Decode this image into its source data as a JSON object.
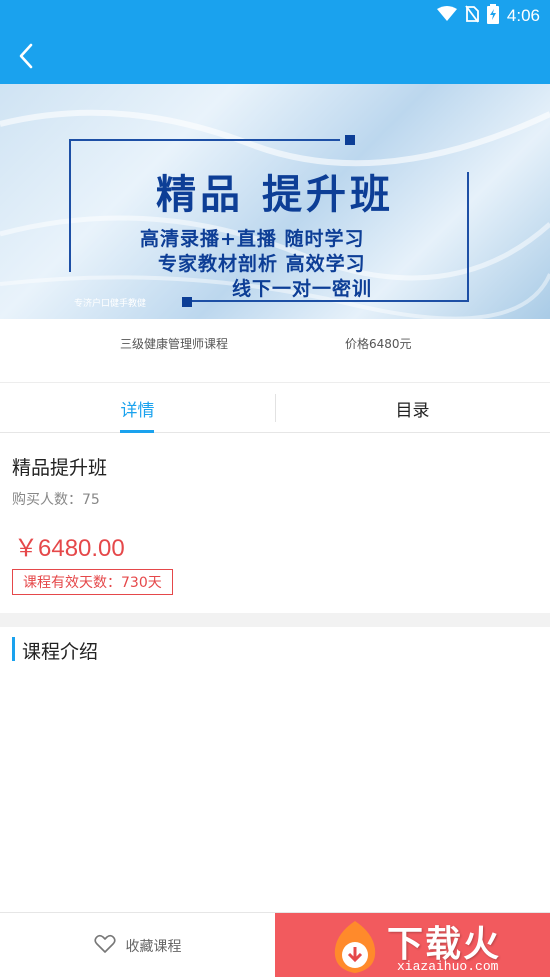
{
  "status_bar": {
    "time": "4:06",
    "icons": [
      "wifi-icon",
      "no-sim-icon",
      "battery-charging-icon"
    ],
    "color": "#1aa2ee"
  },
  "app_bar": {
    "back_icon": "chevron-left-icon"
  },
  "banner": {
    "title": "精品  提升班",
    "line1": "高清录播+直播  随时学习",
    "line2": "专家教材剖析  高效学习",
    "line3": "线下一对一密训",
    "small_text": "专济户口健手教健"
  },
  "course_meta": {
    "name": "三级健康管理师课程",
    "price": "价格6480元"
  },
  "tabs": [
    {
      "label": "详情",
      "active": true
    },
    {
      "label": "目录",
      "active": false
    }
  ],
  "course": {
    "title": "精品提升班",
    "buyers": "购买人数：75",
    "price": "￥6480.00",
    "validity": "课程有效天数：730天"
  },
  "intro": {
    "title": "课程介绍"
  },
  "bottom_bar": {
    "favorite_label": "收藏课程",
    "favorite_icon": "heart-outline-icon",
    "buy_color": "#f25a5e"
  },
  "watermark": {
    "text": "下载火",
    "url": "xiazaihuo.com"
  },
  "colors": {
    "accent": "#1aa2ee",
    "price": "#e5484a"
  }
}
